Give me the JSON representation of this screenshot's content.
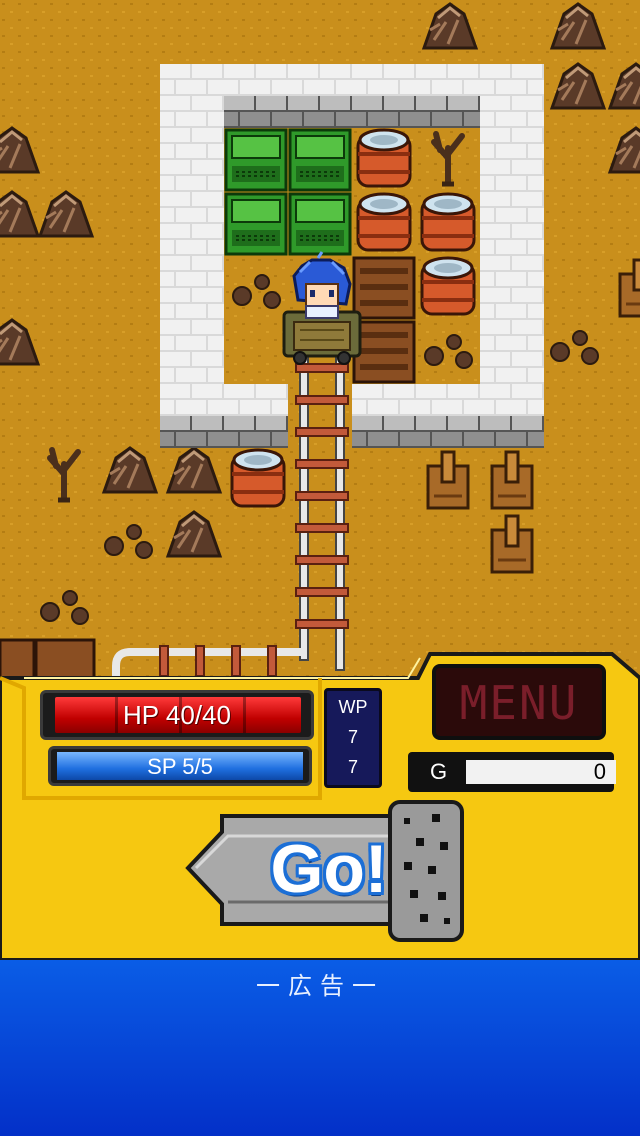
{
  "status": {
    "hp_label": "HP 40/40",
    "hp_current": 40,
    "hp_max": 40,
    "sp_label": "SP 5/5",
    "sp_current": 5,
    "sp_max": 5,
    "wp_label": "WP",
    "wp_value_1": "7",
    "wp_value_2": "7"
  },
  "menu": {
    "label": "MENU"
  },
  "gold": {
    "label": "G",
    "value": "0"
  },
  "go_button": {
    "label": "Go!"
  },
  "ad": {
    "label": "一広告一"
  },
  "colors": {
    "ground": "#c98f1c",
    "hud_yellow": "#f6c811",
    "hp_red": "#d40000",
    "sp_blue": "#1f6fe0",
    "ad_blue": "#0a4fe0"
  }
}
